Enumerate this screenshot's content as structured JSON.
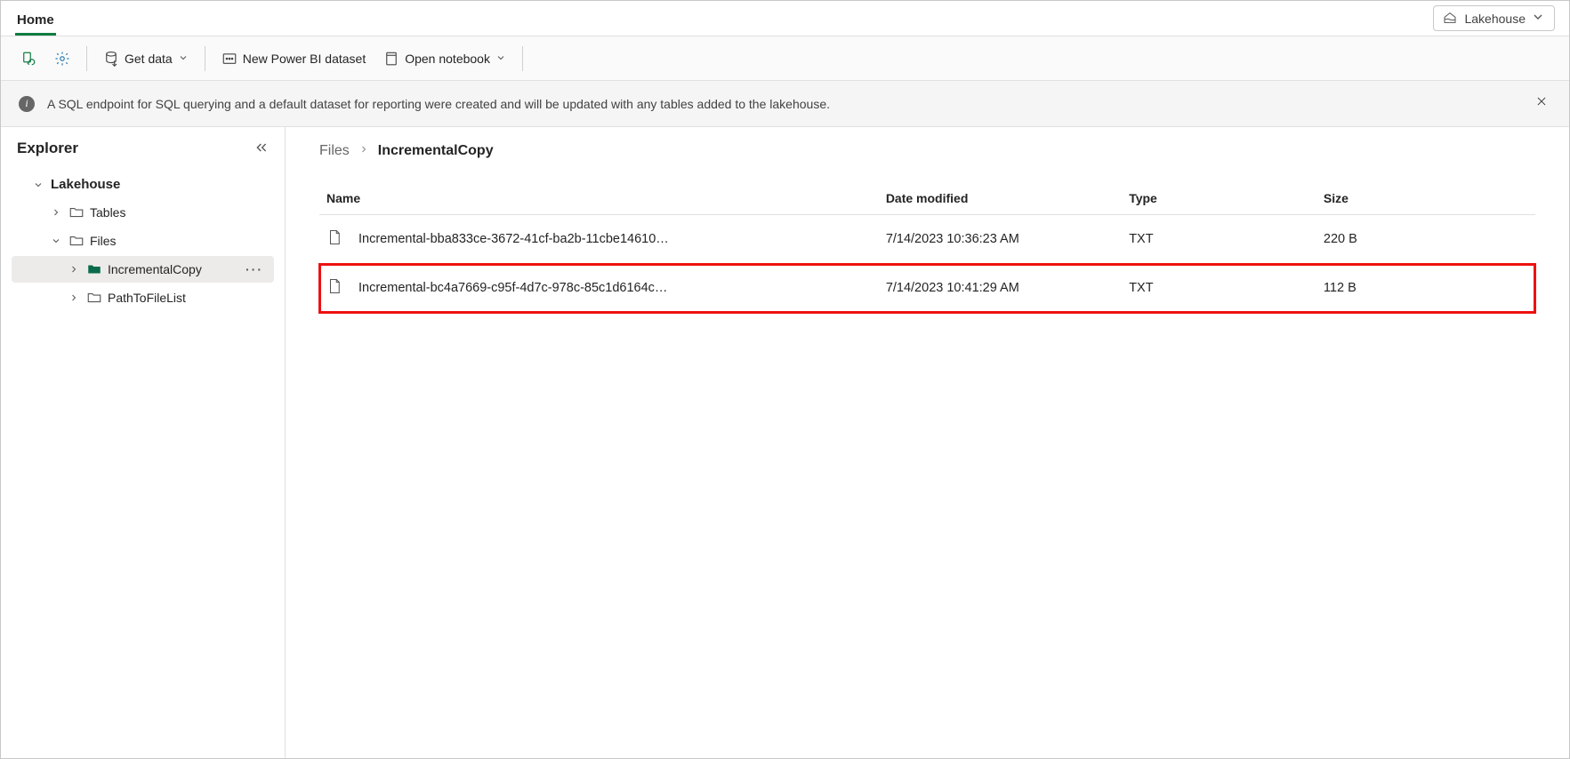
{
  "titlebar": {
    "tab_home": "Home",
    "mode_label": "Lakehouse"
  },
  "toolbar": {
    "get_data": "Get data",
    "new_dataset": "New Power BI dataset",
    "open_notebook": "Open notebook"
  },
  "notice": {
    "text": "A SQL endpoint for SQL querying and a default dataset for reporting were created and will be updated with any tables added to the lakehouse."
  },
  "explorer": {
    "title": "Explorer",
    "root": "Lakehouse",
    "tables": "Tables",
    "files": "Files",
    "incremental_copy": "IncrementalCopy",
    "path_to_file_list": "PathToFileList"
  },
  "breadcrumb": {
    "files": "Files",
    "current": "IncrementalCopy"
  },
  "columns": {
    "name": "Name",
    "date": "Date modified",
    "type": "Type",
    "size": "Size"
  },
  "rows": [
    {
      "name": "Incremental-bba833ce-3672-41cf-ba2b-11cbe14610…",
      "date": "7/14/2023 10:36:23 AM",
      "type": "TXT",
      "size": "220 B",
      "highlight": false
    },
    {
      "name": "Incremental-bc4a7669-c95f-4d7c-978c-85c1d6164c…",
      "date": "7/14/2023 10:41:29 AM",
      "type": "TXT",
      "size": "112 B",
      "highlight": true
    }
  ]
}
